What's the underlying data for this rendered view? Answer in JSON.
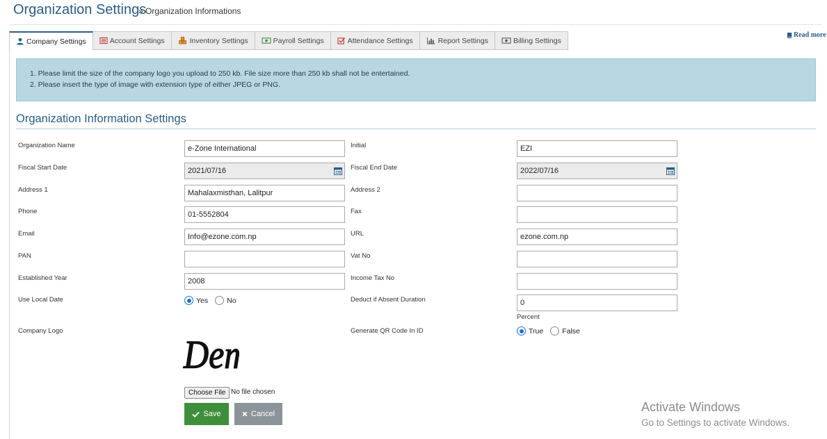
{
  "header": {
    "title": "Organization Settings",
    "breadcrumb": "» Organization Informations"
  },
  "tabs": [
    {
      "label": "Company Settings",
      "icon": "user-icon",
      "active": true
    },
    {
      "label": "Account Settings",
      "icon": "account-list-icon",
      "active": false
    },
    {
      "label": "Inventory Settings",
      "icon": "cubes-icon",
      "active": false
    },
    {
      "label": "Payroll Settings",
      "icon": "money-icon",
      "active": false
    },
    {
      "label": "Attendance Settings",
      "icon": "checkbox-icon",
      "active": false
    },
    {
      "label": "Report Settings",
      "icon": "bar-chart-icon",
      "active": false
    },
    {
      "label": "Billing Settings",
      "icon": "billing-icon",
      "active": false
    }
  ],
  "read_more": "Read more",
  "notice": {
    "line1": "1. Please limit the size of the company logo you upload to 250 kb. File size more than 250 kb shall not be entertained.",
    "line2": "2. Please insert the type of image with extension type of either JPEG or PNG."
  },
  "section": {
    "title": "Organization Information Settings"
  },
  "form": {
    "organization_name": {
      "label": "Organization Name",
      "value": "e-Zone International"
    },
    "initial": {
      "label": "Initial",
      "value": "EZI"
    },
    "fiscal_start_date": {
      "label": "Fiscal Start Date",
      "value": "2021/07/16"
    },
    "fiscal_end_date": {
      "label": "Fiscal End Date",
      "value": "2022/07/16"
    },
    "address1": {
      "label": "Address 1",
      "value": "Mahalaxmisthan, Lalitpur"
    },
    "address2": {
      "label": "Address 2",
      "value": ""
    },
    "phone": {
      "label": "Phone",
      "value": "01-5552804"
    },
    "fax": {
      "label": "Fax",
      "value": ""
    },
    "email": {
      "label": "Email",
      "value": "Info@ezone.com.np"
    },
    "url": {
      "label": "URL",
      "value": "ezone.com.np"
    },
    "pan": {
      "label": "PAN",
      "value": ""
    },
    "vat_no": {
      "label": "Vat No",
      "value": ""
    },
    "established_year": {
      "label": "Established Year",
      "value": "2008"
    },
    "income_tax_no": {
      "label": "Income Tax No",
      "value": ""
    },
    "use_local_date": {
      "label": "Use Local Date",
      "options": [
        "Yes",
        "No"
      ],
      "selected": "Yes"
    },
    "deduct_absent": {
      "label": "Deduct if Absent Duration",
      "value": "0",
      "unit": "Percent"
    },
    "company_logo": {
      "label": "Company Logo",
      "logo_text": "Demo"
    },
    "generate_qr": {
      "label": "Generate QR Code In ID",
      "options": [
        "True",
        "False"
      ],
      "selected": "True"
    }
  },
  "file_input": {
    "button": "Choose File",
    "status": "No file chosen"
  },
  "actions": {
    "save": "Save",
    "cancel": "Cancel"
  },
  "watermark": {
    "title": "Activate Windows",
    "subtitle": "Go to Settings to activate Windows."
  },
  "colors": {
    "accent": "#2a5d84",
    "notice_bg": "#b9d7e2",
    "save": "#3f8e3b",
    "cancel": "#8a9499",
    "radio": "#1a73c9"
  }
}
